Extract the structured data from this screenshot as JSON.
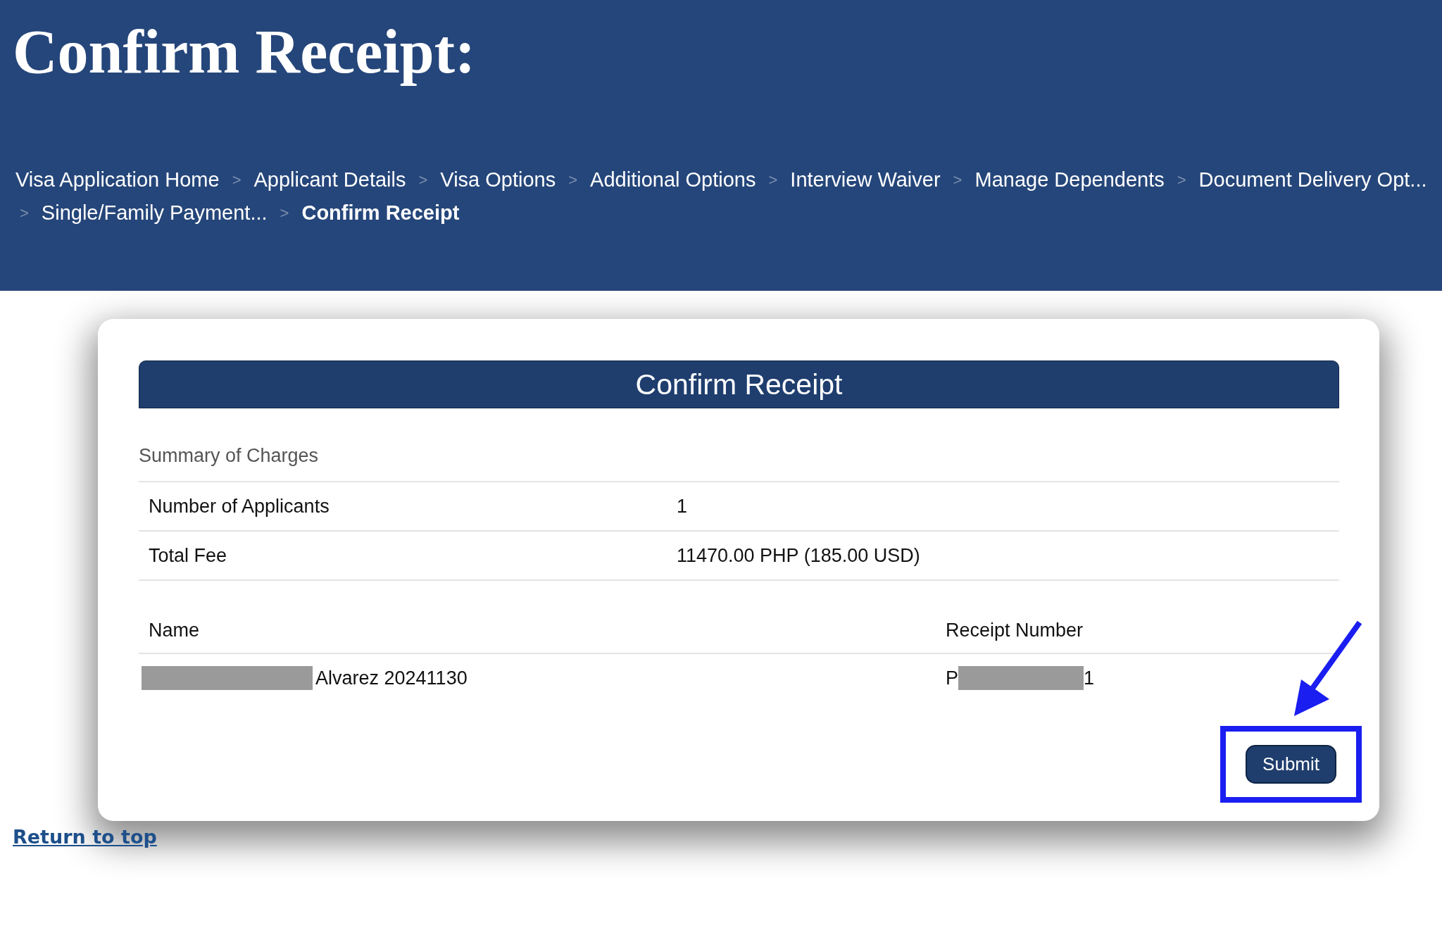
{
  "header": {
    "title": "Confirm Receipt:"
  },
  "breadcrumb_rows": [
    [
      {
        "kind": "crumb",
        "label": "Visa Application Home",
        "selected": false
      },
      {
        "kind": "separator",
        "label": ">"
      },
      {
        "kind": "crumb",
        "label": "Applicant Details",
        "selected": false
      },
      {
        "kind": "separator",
        "label": ">"
      },
      {
        "kind": "crumb",
        "label": "Visa Options",
        "selected": false
      },
      {
        "kind": "separator",
        "label": ">"
      },
      {
        "kind": "crumb",
        "label": "Additional Options",
        "selected": false
      },
      {
        "kind": "separator",
        "label": ">"
      },
      {
        "kind": "crumb",
        "label": "Interview Waiver",
        "selected": false
      },
      {
        "kind": "separator",
        "label": ">"
      },
      {
        "kind": "crumb",
        "label": "Manage Dependents",
        "selected": false
      },
      {
        "kind": "separator",
        "label": ">"
      },
      {
        "kind": "crumb",
        "label": "Document Delivery Opt...",
        "selected": false
      }
    ],
    [
      {
        "kind": "separator",
        "label": ">"
      },
      {
        "kind": "crumb",
        "label": "Single/Family Payment...",
        "selected": false
      },
      {
        "kind": "separator",
        "label": ">"
      },
      {
        "kind": "crumb",
        "label": "Confirm Receipt",
        "selected": true
      }
    ]
  ],
  "card": {
    "title": "Confirm Receipt",
    "section_title": "Summary of Charges",
    "summary_rows": [
      {
        "label": "Number of Applicants",
        "value": "1"
      },
      {
        "label": "Total Fee",
        "value": "11470.00 PHP (185.00 USD)"
      }
    ],
    "applicants_table": {
      "columns": [
        "Name",
        "Receipt Number"
      ],
      "rows": [
        [
          [
            {
              "kind": "redaction"
            },
            {
              "kind": "text",
              "text": "Alvarez 20241130"
            }
          ],
          [
            {
              "kind": "text",
              "text": "P"
            },
            {
              "kind": "redaction"
            },
            {
              "kind": "text",
              "text": "1"
            }
          ]
        ]
      ]
    },
    "submit_button": {
      "label": "Submit",
      "highlighted": true
    }
  },
  "return_link": "Return to top"
}
